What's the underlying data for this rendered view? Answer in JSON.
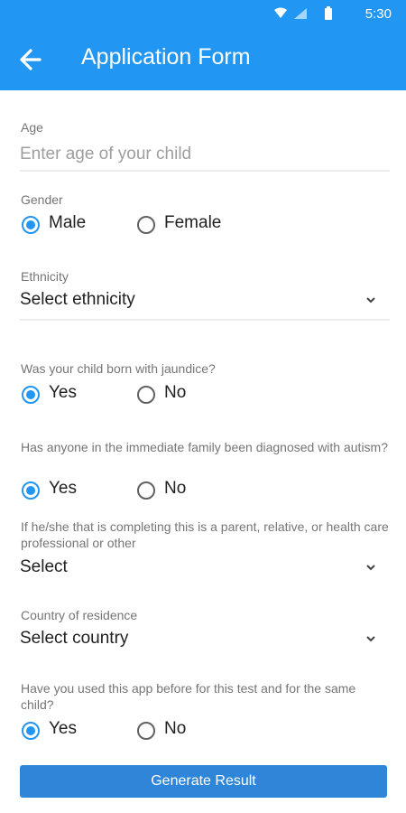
{
  "status": {
    "time": "5:30"
  },
  "header": {
    "title": "Application Form",
    "back_icon": "arrow-left-icon",
    "color": "#2196f3"
  },
  "age": {
    "label": "Age",
    "placeholder": "Enter age of your child",
    "value": ""
  },
  "gender": {
    "label": "Gender",
    "options": [
      "Male",
      "Female"
    ],
    "selected": "Male"
  },
  "ethnicity": {
    "label": "Ethnicity",
    "value": "Select ethnicity"
  },
  "jaundice": {
    "label": "Was your child born with jaundice?",
    "options": [
      "Yes",
      "No"
    ],
    "selected": "Yes"
  },
  "autism": {
    "label": "Has anyone in the immediate family been diagnosed with autism?",
    "options": [
      "Yes",
      "No"
    ],
    "selected": "Yes"
  },
  "relation": {
    "label": "If he/she that is completing this is a parent, relative, or health care professional or other",
    "value": "Select"
  },
  "country": {
    "label": "Country of residence",
    "value": "Select country"
  },
  "used_before": {
    "label": "Have you used this app before for this test and for the same child?",
    "options": [
      "Yes",
      "No"
    ],
    "selected": "Yes"
  },
  "submit": {
    "label": "Generate Result",
    "color": "#2f86d8"
  }
}
